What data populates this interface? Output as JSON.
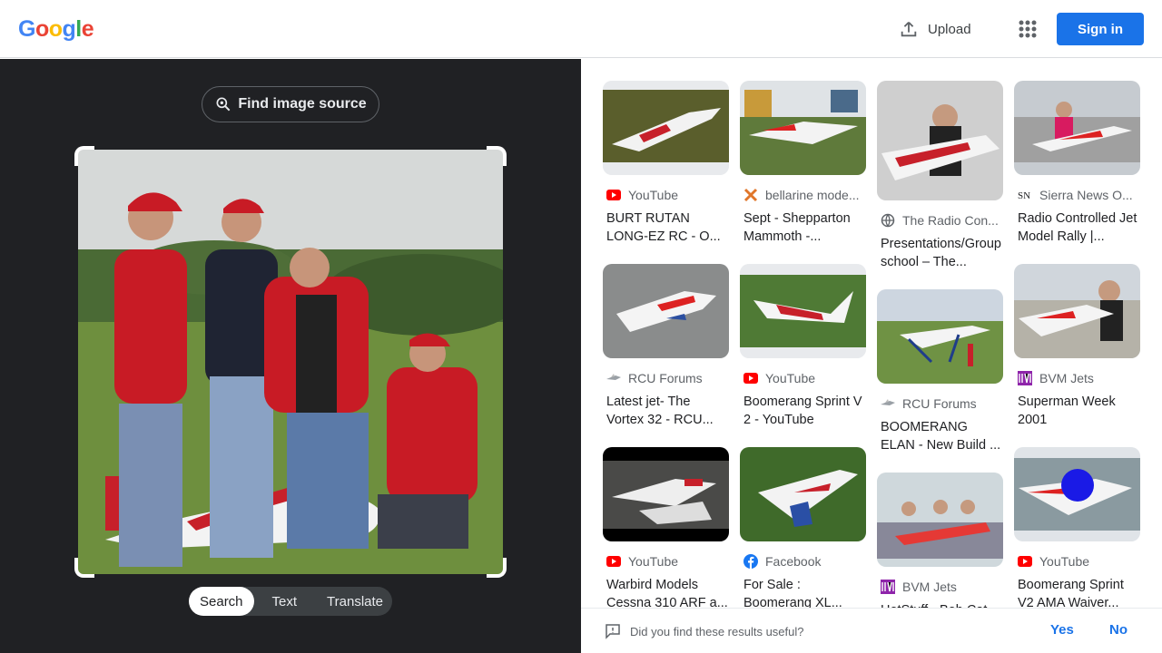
{
  "header": {
    "logo": [
      "G",
      "o",
      "o",
      "g",
      "l",
      "e"
    ],
    "logo_colors": [
      "#4285f4",
      "#ea4335",
      "#fbbc05",
      "#4285f4",
      "#34a853",
      "#ea4335"
    ],
    "upload_label": "Upload",
    "signin_label": "Sign in",
    "accent": "#1a73e8"
  },
  "left": {
    "find_source_label": "Find image source",
    "modes": [
      "Search",
      "Text",
      "Translate"
    ],
    "active_mode": "Search"
  },
  "results": {
    "columns": [
      [
        {
          "source": "YouTube",
          "source_icon": "youtube-icon",
          "title": "BURT RUTAN LONG-EZ RC - O..."
        },
        {
          "source": "RCU Forums",
          "source_icon": "rcu-icon",
          "title": "Latest jet- The Vortex 32 - RCU..."
        },
        {
          "source": "YouTube",
          "source_icon": "youtube-icon",
          "title": "Warbird Models Cessna 310 ARF a..."
        }
      ],
      [
        {
          "source": "bellarine mode...",
          "source_icon": "bellarine-icon",
          "title": "Sept - Shepparton Mammoth -..."
        },
        {
          "source": "YouTube",
          "source_icon": "youtube-icon",
          "title": "Boomerang Sprint V 2 - YouTube"
        },
        {
          "source": "Facebook",
          "source_icon": "facebook-icon",
          "title": "For Sale : Boomerang XL..."
        }
      ],
      [
        {
          "source": "The Radio Con...",
          "source_icon": "globe-icon",
          "title": "Presentations/Group school – The..."
        },
        {
          "source": "RCU Forums",
          "source_icon": "rcu-icon",
          "title": "BOOMERANG ELAN - New Build ..."
        },
        {
          "source": "BVM Jets",
          "source_icon": "bvm-icon",
          "title": "HotStuff - Bob Cat..."
        }
      ],
      [
        {
          "source": "Sierra News O...",
          "source_icon": "sierra-icon",
          "title": "Radio Controlled Jet Model Rally |..."
        },
        {
          "source": "BVM Jets",
          "source_icon": "bvm-icon",
          "title": "Superman Week 2001"
        },
        {
          "source": "YouTube",
          "source_icon": "youtube-icon",
          "title": "Boomerang Sprint V2 AMA Waiver..."
        }
      ]
    ]
  },
  "feedback": {
    "question": "Did you find these results useful?",
    "yes": "Yes",
    "no": "No"
  }
}
